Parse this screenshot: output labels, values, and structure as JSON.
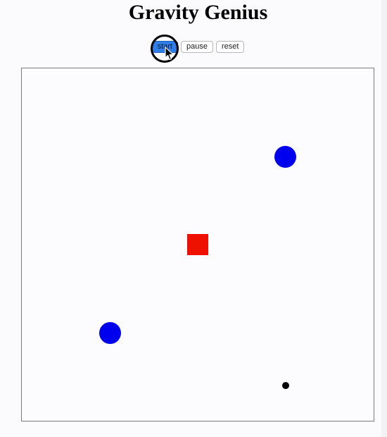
{
  "header": {
    "title": "Gravity Genius"
  },
  "controls": {
    "start_label": "start",
    "pause_label": "pause",
    "reset_label": "reset"
  },
  "simulation": {
    "bodies": [
      {
        "kind": "planet",
        "shape": "circle",
        "color": "#0000ee"
      },
      {
        "kind": "sun",
        "shape": "square",
        "color": "#ee1100"
      },
      {
        "kind": "planet",
        "shape": "circle",
        "color": "#0000ee"
      },
      {
        "kind": "particle",
        "shape": "circle",
        "color": "#000000"
      }
    ]
  },
  "colors": {
    "accent": "#2f7de6",
    "planet": "#0000ee",
    "sun": "#ee1100",
    "particle": "#000000"
  },
  "icons": {
    "cursor": "pointer-cursor-icon",
    "click_indicator": "click-ring-icon"
  }
}
